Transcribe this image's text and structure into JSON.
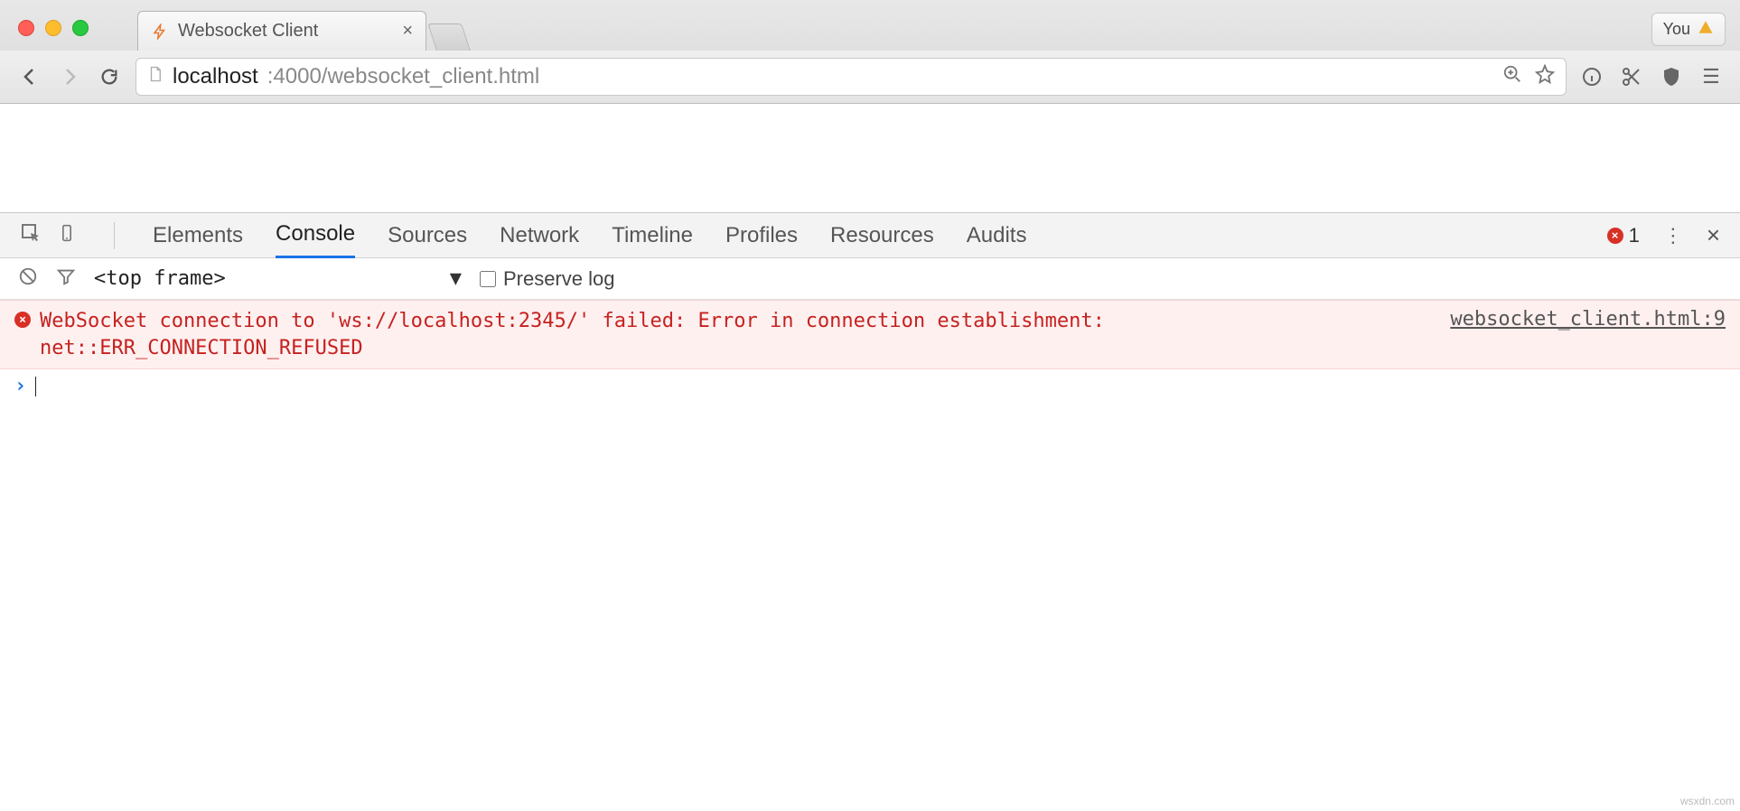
{
  "browser": {
    "tab_title": "Websocket Client",
    "profile_label": "You",
    "url_host": "localhost",
    "url_port_path": ":4000/websocket_client.html"
  },
  "devtools": {
    "tabs": [
      "Elements",
      "Console",
      "Sources",
      "Network",
      "Timeline",
      "Profiles",
      "Resources",
      "Audits"
    ],
    "active_tab": "Console",
    "error_count": "1",
    "frame_selector": "<top frame>",
    "preserve_log_label": "Preserve log"
  },
  "console": {
    "error_text": "WebSocket connection to 'ws://localhost:2345/' failed: Error in connection establishment:\nnet::ERR_CONNECTION_REFUSED",
    "error_source": "websocket_client.html:9"
  },
  "watermark": "wsxdn.com"
}
